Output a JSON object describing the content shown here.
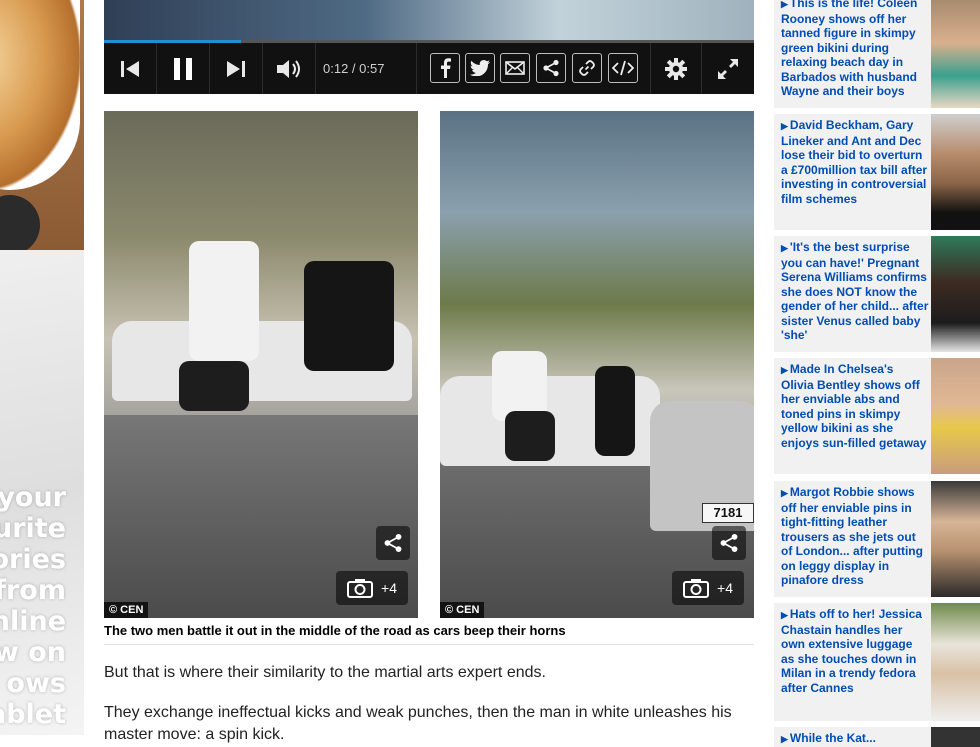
{
  "left_ad": {
    "promo_lines": [
      "your",
      "urite",
      "ories",
      "from",
      "nline",
      "w on",
      "ows",
      "ablet"
    ]
  },
  "video": {
    "time_current": "0:12",
    "time_total": "0:57",
    "time_separator": " / ",
    "progress": 0.21,
    "icons": [
      "skip-back-icon",
      "pause-icon",
      "skip-forward-icon",
      "volume-icon",
      "facebook-icon",
      "twitter-icon",
      "email-icon",
      "share-icon",
      "link-icon",
      "embed-icon",
      "settings-icon",
      "fullscreen-icon"
    ]
  },
  "photos": [
    {
      "credit": "© CEN",
      "gallery_count": "+4"
    },
    {
      "credit": "© CEN",
      "gallery_count": "+4",
      "plate": "7181"
    }
  ],
  "caption": "The two men battle it out in the middle of the road as cars beep their horns",
  "paragraphs": [
    "But that is where their similarity to the martial arts expert ends.",
    "They exchange ineffectual kicks and weak punches, then the man in white unleashes his master move: a spin kick."
  ],
  "sidebar": {
    "items": [
      {
        "headline": "This is the life! Coleen Rooney shows off her tanned figure in skimpy green bikini during relaxing beach day in Barbados with husband Wayne and their boys"
      },
      {
        "headline": "David Beckham, Gary Lineker and Ant and Dec lose their bid to overturn a £700million tax bill after investing in controversial film schemes"
      },
      {
        "headline": "'It's the best surprise you can have!' Pregnant Serena Williams confirms she does NOT know the gender of her child... after sister Venus called baby 'she'"
      },
      {
        "headline": "Made In Chelsea's Olivia Bentley shows off her enviable abs and toned pins in skimpy yellow bikini as she enjoys sun-filled getaway"
      },
      {
        "headline": "Margot Robbie shows off her enviable pins in tight-fitting leather trousers as she jets out of London... after putting on leggy display in pinafore dress"
      },
      {
        "headline": "Hats off to her! Jessica Chastain handles her own extensive luggage as she touches down in Milan in a trendy fedora after Cannes"
      },
      {
        "headline": "While the Kat..."
      }
    ]
  },
  "colors": {
    "link_blue": "#004db3",
    "progress_blue": "#1f8fd6",
    "sidebar_bg": "#f1f1f1",
    "player_bg": "#111111"
  }
}
